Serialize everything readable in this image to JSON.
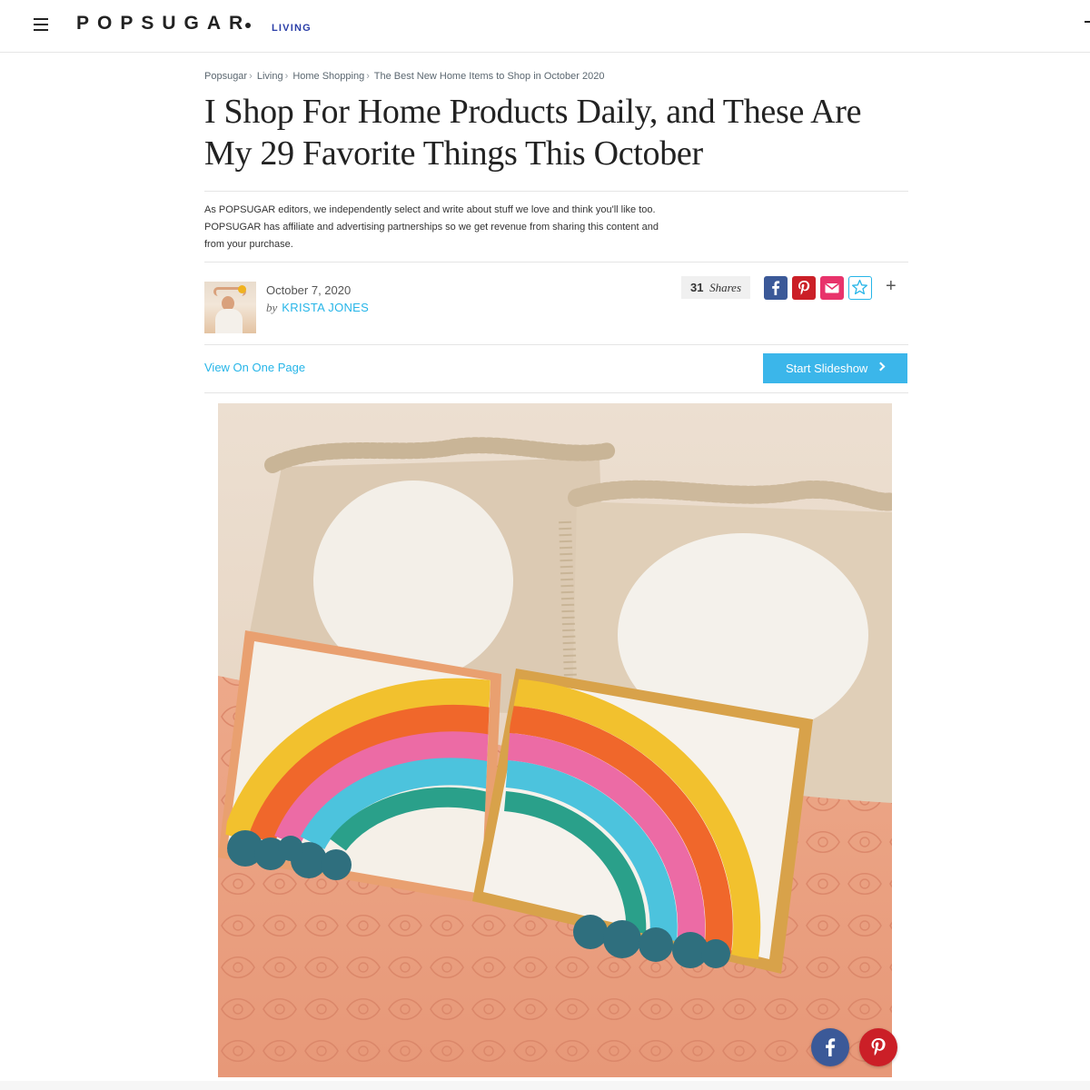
{
  "nav": {
    "logo": "POPSUGAR",
    "section": "LIVING"
  },
  "breadcrumb": [
    {
      "label": "Popsugar"
    },
    {
      "label": "Living"
    },
    {
      "label": "Home Shopping"
    },
    {
      "label": "The Best New Home Items to Shop in October 2020"
    }
  ],
  "breadcrumb_separator": "›",
  "article": {
    "title_line1": "I Shop For Home Products Daily, and These Are",
    "title_line2": "My 29 Favorite Things This October",
    "disclaimer_line1": "As POPSUGAR editors, we independently select and write about stuff we love and think you'll like too.",
    "disclaimer_line2": "POPSUGAR has affiliate and advertising partnerships so we get revenue from sharing this content and",
    "disclaimer_line3": "from your purchase.",
    "date": "October 7, 2020",
    "by_prefix": "by",
    "author": "KRISTA JONES"
  },
  "share": {
    "count": "31",
    "count_label": "Shares",
    "more": "+"
  },
  "actions": {
    "view_one_page": "View On One Page",
    "start_slideshow": "Start Slideshow"
  },
  "icons": {
    "menu": "hamburger-menu-icon",
    "facebook": "facebook-icon",
    "pinterest": "pinterest-icon",
    "email": "email-icon",
    "favorite": "star-icon",
    "more": "plus-icon",
    "chevron": "chevron-right-icon"
  },
  "colors": {
    "accent": "#26b5e8",
    "button": "#3bb6ea",
    "facebook": "#3b5998",
    "pinterest": "#cb1f27",
    "email": "#e8336b",
    "section_tag": "#2b3fa8"
  }
}
